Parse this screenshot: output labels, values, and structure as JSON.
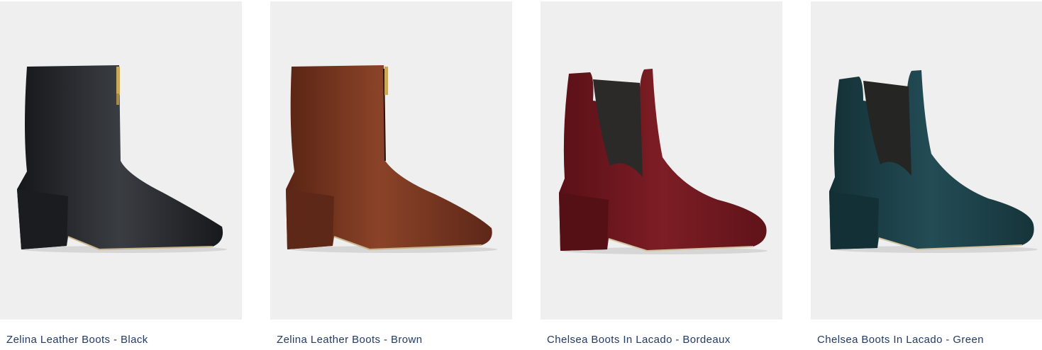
{
  "products": [
    {
      "name": "Zelina Leather Boots - Black",
      "image": "black-zip-ankle-boot",
      "color": "#1f2124"
    },
    {
      "name": "Zelina Leather Boots - Brown",
      "image": "brown-zip-ankle-boot",
      "color": "#6b2e1c"
    },
    {
      "name": "Chelsea Boots In Lacado - Bordeaux",
      "image": "bordeaux-chelsea-boot",
      "color": "#6e1820"
    },
    {
      "name": "Chelsea Boots In Lacado - Green",
      "image": "green-chelsea-boot",
      "color": "#1e4048"
    }
  ],
  "colors": {
    "tile_bg": "#efefef",
    "title": "#223a66"
  }
}
